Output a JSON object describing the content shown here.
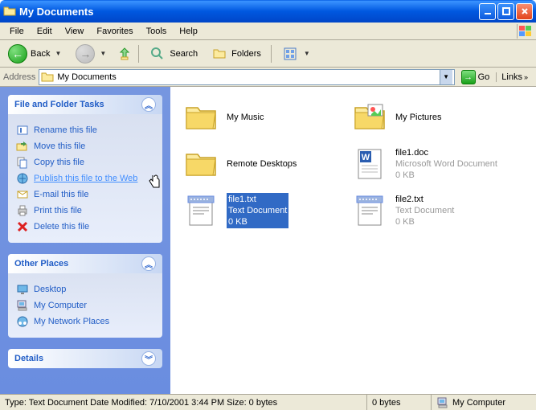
{
  "window": {
    "title": "My Documents"
  },
  "menubar": [
    "File",
    "Edit",
    "View",
    "Favorites",
    "Tools",
    "Help"
  ],
  "toolbar": {
    "back": "Back",
    "search": "Search",
    "folders": "Folders"
  },
  "addressbar": {
    "label": "Address",
    "value": "My Documents",
    "go": "Go",
    "links": "Links"
  },
  "sidebar": {
    "tasks": {
      "title": "File and Folder Tasks",
      "items": [
        "Rename this file",
        "Move this file",
        "Copy this file",
        "Publish this file to the Web",
        "E-mail this file",
        "Print this file",
        "Delete this file"
      ]
    },
    "places": {
      "title": "Other Places",
      "items": [
        "Desktop",
        "My Computer",
        "My Network Places"
      ]
    },
    "details": {
      "title": "Details"
    }
  },
  "files": [
    {
      "name": "My Music",
      "type": "folder"
    },
    {
      "name": "My Pictures",
      "type": "folder-pics"
    },
    {
      "name": "Remote Desktops",
      "type": "folder"
    },
    {
      "name": "file1.doc",
      "type": "doc",
      "desc": "Microsoft Word Document",
      "size": "0 KB"
    },
    {
      "name": "file1.txt",
      "type": "txt",
      "desc": "Text Document",
      "size": "0 KB",
      "selected": true
    },
    {
      "name": "file2.txt",
      "type": "txt",
      "desc": "Text Document",
      "size": "0 KB"
    }
  ],
  "statusbar": {
    "main": "Type: Text Document Date Modified: 7/10/2001 3:44 PM Size: 0 bytes",
    "size": "0 bytes",
    "zone": "My Computer"
  }
}
